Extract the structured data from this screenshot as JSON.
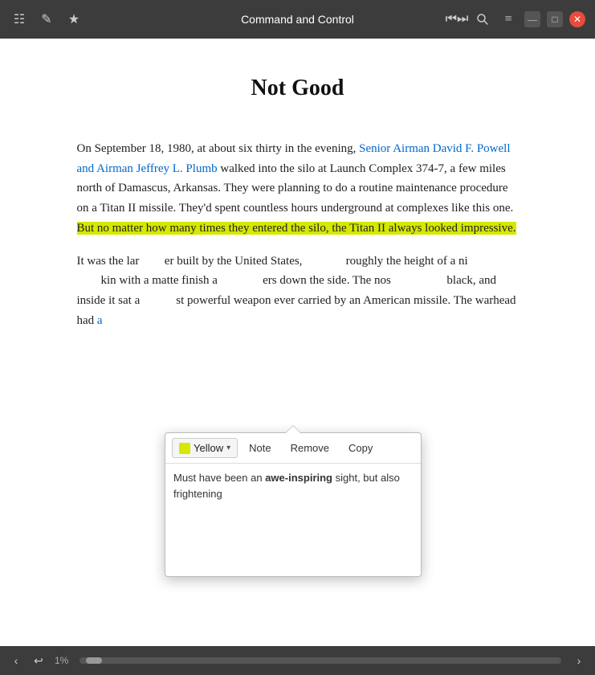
{
  "titlebar": {
    "title": "Command and Control",
    "icons": {
      "menu": "☰",
      "edit": "✎",
      "star": "★",
      "audio": "◀▶",
      "search": "🔍",
      "settings": "≡",
      "minimize": "—",
      "maximize": "□",
      "close": "✕"
    }
  },
  "content": {
    "chapter_title": "Not Good",
    "paragraph1_start": "On September 18, 1980, at about six thirty in the evening, ",
    "paragraph1_link": "Senior Airman David F. Powell and Airman Jeffrey L. Plumb",
    "paragraph1_end": " walked into the silo at Launch Complex 374-7, a few miles north of Damascus, Arkansas. They were planning to do a routine maintenance procedure on a Titan II missile. They'd spent countless hours underground at complexes like this one. ",
    "paragraph1_highlighted": "But no matter how many times they entered the silo, the Titan II always looked impressive.",
    "paragraph2_start": "It was the lar",
    "paragraph2_end": "er built by the United States,",
    "paragraph2_middle": "roughly the height of a ni",
    "paragraph2_skin": "kin with a matte finish a",
    "paragraph2_numbers": "ers down the side. The nos",
    "paragraph2_color": "black, and inside it sat a",
    "paragraph2_powerful": "st powerful weapon ever carried by an American missile. The warhead had ",
    "paragraph2_link2": "a",
    "link_color": "#0066cc",
    "highlight_color": "#d4e800"
  },
  "annotation": {
    "color_label": "Yellow",
    "note_btn": "Note",
    "remove_btn": "Remove",
    "copy_btn": "Copy",
    "note_text_part1": "Must have been an awe-inspiring sight, but",
    "note_text_part2": "also frightening",
    "note_bold_word": "awe-inspiring"
  },
  "bottombar": {
    "prev_label": "‹",
    "next_label": "›",
    "back_label": "↩",
    "page_percent": "1%"
  }
}
